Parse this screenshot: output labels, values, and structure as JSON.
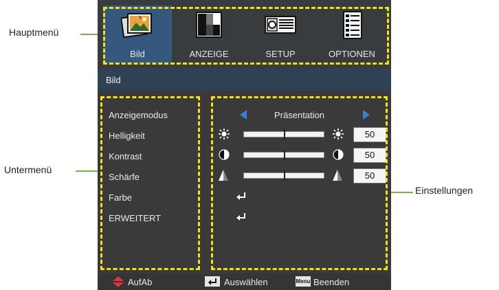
{
  "annotations": {
    "main_menu": "Hauptmenü",
    "sub_menu": "Untermenü",
    "settings": "Einstellungen"
  },
  "tabs": [
    {
      "label": "Bild",
      "icon": "picture-icon",
      "active": true
    },
    {
      "label": "ANZEIGE",
      "icon": "display-icon",
      "active": false
    },
    {
      "label": "SETUP",
      "icon": "projector-icon",
      "active": false
    },
    {
      "label": "OPTIONEN",
      "icon": "options-document-icon",
      "active": false
    }
  ],
  "section_title": "Bild",
  "submenu": [
    "Anzeigemodus",
    "Helligkeit",
    "Kontrast",
    "Schärfe",
    "Farbe",
    "ERWEITERT"
  ],
  "settings": {
    "mode_value": "Präsentation",
    "brightness": {
      "value": "50",
      "level": 0.5,
      "icon": "sun-icon"
    },
    "contrast": {
      "value": "50",
      "level": 0.5,
      "icon": "half-circle-icon"
    },
    "sharpness": {
      "value": "50",
      "level": 0.5,
      "icon": "sharpness-triangle-icon"
    }
  },
  "footer": {
    "updown": "AufAb",
    "select": "Auswählen",
    "menu_key": "Menu",
    "exit": "Beenden"
  },
  "colors": {
    "highlight_dash": "#f1e21c",
    "callout_green": "#7ab540",
    "active_tab": "#35597e",
    "arrow_blue": "#3b82d6",
    "footer_arrow_red": "#e0343a"
  }
}
